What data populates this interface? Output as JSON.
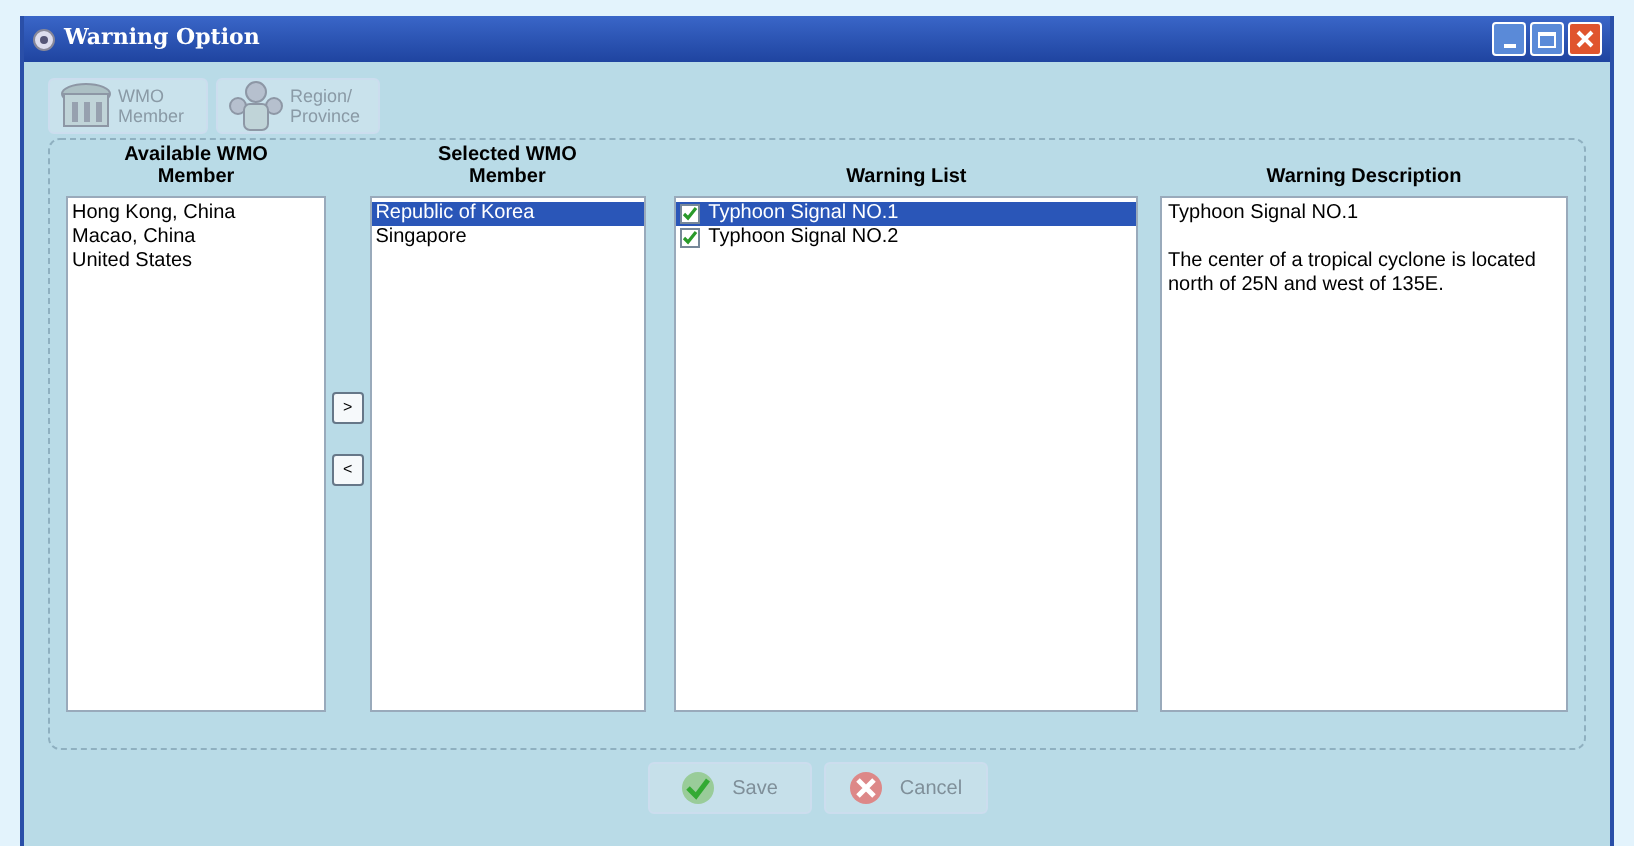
{
  "window": {
    "title": "Warning Option"
  },
  "toolbar": [
    {
      "kind": "member",
      "label": "WMO Member",
      "disabled": true
    },
    {
      "kind": "region",
      "label": "Region/ Province",
      "disabled": true
    }
  ],
  "available": {
    "heading": "Available WMO Member",
    "items": [
      {
        "label": "Hong Kong, China",
        "selected": false
      },
      {
        "label": "Macao, China",
        "selected": false
      },
      {
        "label": "United States",
        "selected": false
      }
    ]
  },
  "move_buttons": [
    ">",
    "<"
  ],
  "selected_members": {
    "heading": "Selected WMO Member",
    "items": [
      {
        "label": "Republic of Korea",
        "selected": true
      },
      {
        "label": "Singapore",
        "selected": false
      }
    ]
  },
  "warning_list": {
    "heading": "Warning List",
    "items": [
      {
        "label": "Typhoon Signal NO.1",
        "checked": true,
        "selected": true
      },
      {
        "label": "Typhoon Signal NO.2",
        "checked": true,
        "selected": false
      }
    ]
  },
  "description": {
    "heading": "Warning Description",
    "title": "Typhoon Signal NO.1",
    "text": "The center of a tropical cyclone is located north of 25N and west of 135E."
  },
  "buttons": [
    {
      "kind": "save",
      "label": "Save",
      "disabled": true
    },
    {
      "kind": "cancel",
      "label": "Cancel",
      "disabled": true
    }
  ]
}
